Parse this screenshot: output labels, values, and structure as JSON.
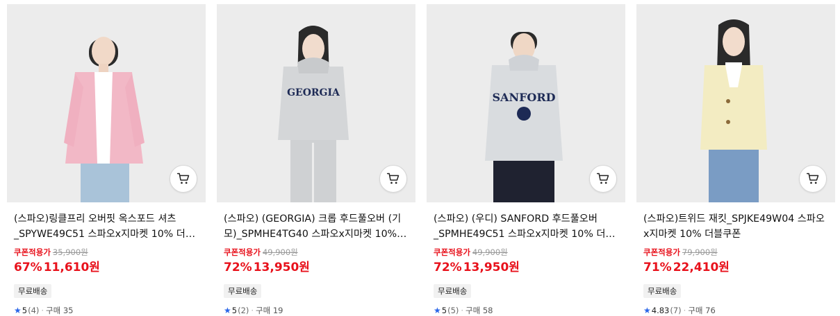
{
  "products": [
    {
      "title": "(스파오)링클프리 오버핏 옥스포드 셔츠 _SPYWE49C51 스파오x지마켓 10% 더…",
      "coupon_label": "쿠폰적용가",
      "original_price": "35,900원",
      "discount": "67%",
      "price": "11,610원",
      "shipping": "무료배송",
      "rating": "5",
      "review_count": "(4)",
      "sales": "구매 35",
      "colors": {
        "top": "#f2b8c6",
        "inner": "#ffffff",
        "bottom": "#a9c3d9"
      }
    },
    {
      "title": "(스파오) (GEORGIA) 크롭 후드풀오버 (기모)_SPMHE4TG40 스파오x지마켓 10%…",
      "coupon_label": "쿠폰적용가",
      "original_price": "49,900원",
      "discount": "72%",
      "price": "13,950원",
      "shipping": "무료배송",
      "rating": "5",
      "review_count": "(2)",
      "sales": "구매 19",
      "colors": {
        "top": "#d4d6d8",
        "inner": "#d4d6d8",
        "bottom": "#cfd1d3"
      }
    },
    {
      "title": "(스파오) (우디) SANFORD 후드풀오버 _SPMHE49C51 스파오x지마켓 10% 더…",
      "coupon_label": "쿠폰적용가",
      "original_price": "49,900원",
      "discount": "72%",
      "price": "13,950원",
      "shipping": "무료배송",
      "rating": "5",
      "review_count": "(5)",
      "sales": "구매 58",
      "colors": {
        "top": "#d9dcdf",
        "inner": "#d9dcdf",
        "bottom": "#1f2230"
      }
    },
    {
      "title": "(스파오)트위드 재킷_SPJKE49W04 스파오x지마켓 10% 더블쿠폰",
      "coupon_label": "쿠폰적용가",
      "original_price": "79,900원",
      "discount": "71%",
      "price": "22,410원",
      "shipping": "무료배송",
      "rating": "4.83",
      "review_count": "(7)",
      "sales": "구매 76",
      "colors": {
        "top": "#f3ecc2",
        "inner": "#ffffff",
        "bottom": "#7a9cc4"
      }
    }
  ],
  "icons": {
    "cart": "cart-icon",
    "star": "star-icon"
  },
  "accent_color": "#e8121c",
  "star_color": "#2a66e8"
}
